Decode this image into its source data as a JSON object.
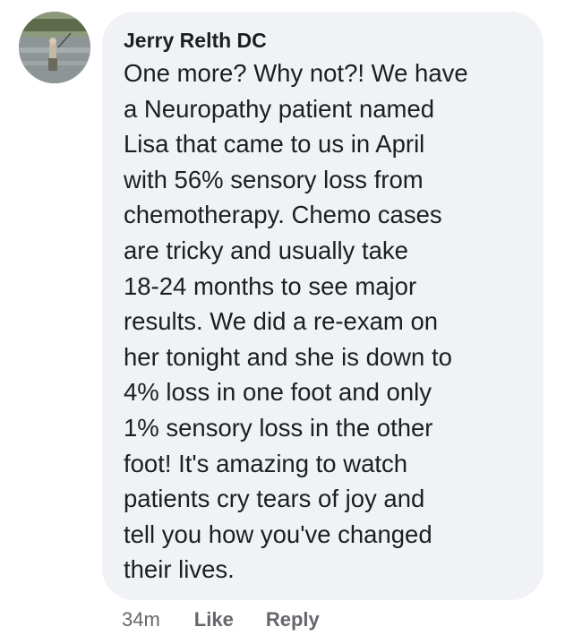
{
  "comment": {
    "author": "Jerry Relth DC",
    "text_lines": [
      "One more? Why not?! We have",
      "a Neuropathy patient named",
      "Lisa that came to us in April",
      "with 56% sensory loss from",
      "chemotherapy. Chemo cases",
      "are tricky and usually take",
      "18-24 months to see major",
      "results. We did a re-exam on",
      "her tonight and she is down to",
      "4% loss in one foot and only",
      "1% sensory loss in the other",
      "foot! It's amazing to watch",
      "patients cry tears of joy and",
      "tell you how you've changed",
      "their lives."
    ]
  },
  "actions": {
    "timestamp": "34m",
    "like_label": "Like",
    "reply_label": "Reply"
  },
  "colors": {
    "bubble_bg": "#f0f2f5",
    "text": "#1c1e21",
    "secondary_text": "#65676b"
  }
}
